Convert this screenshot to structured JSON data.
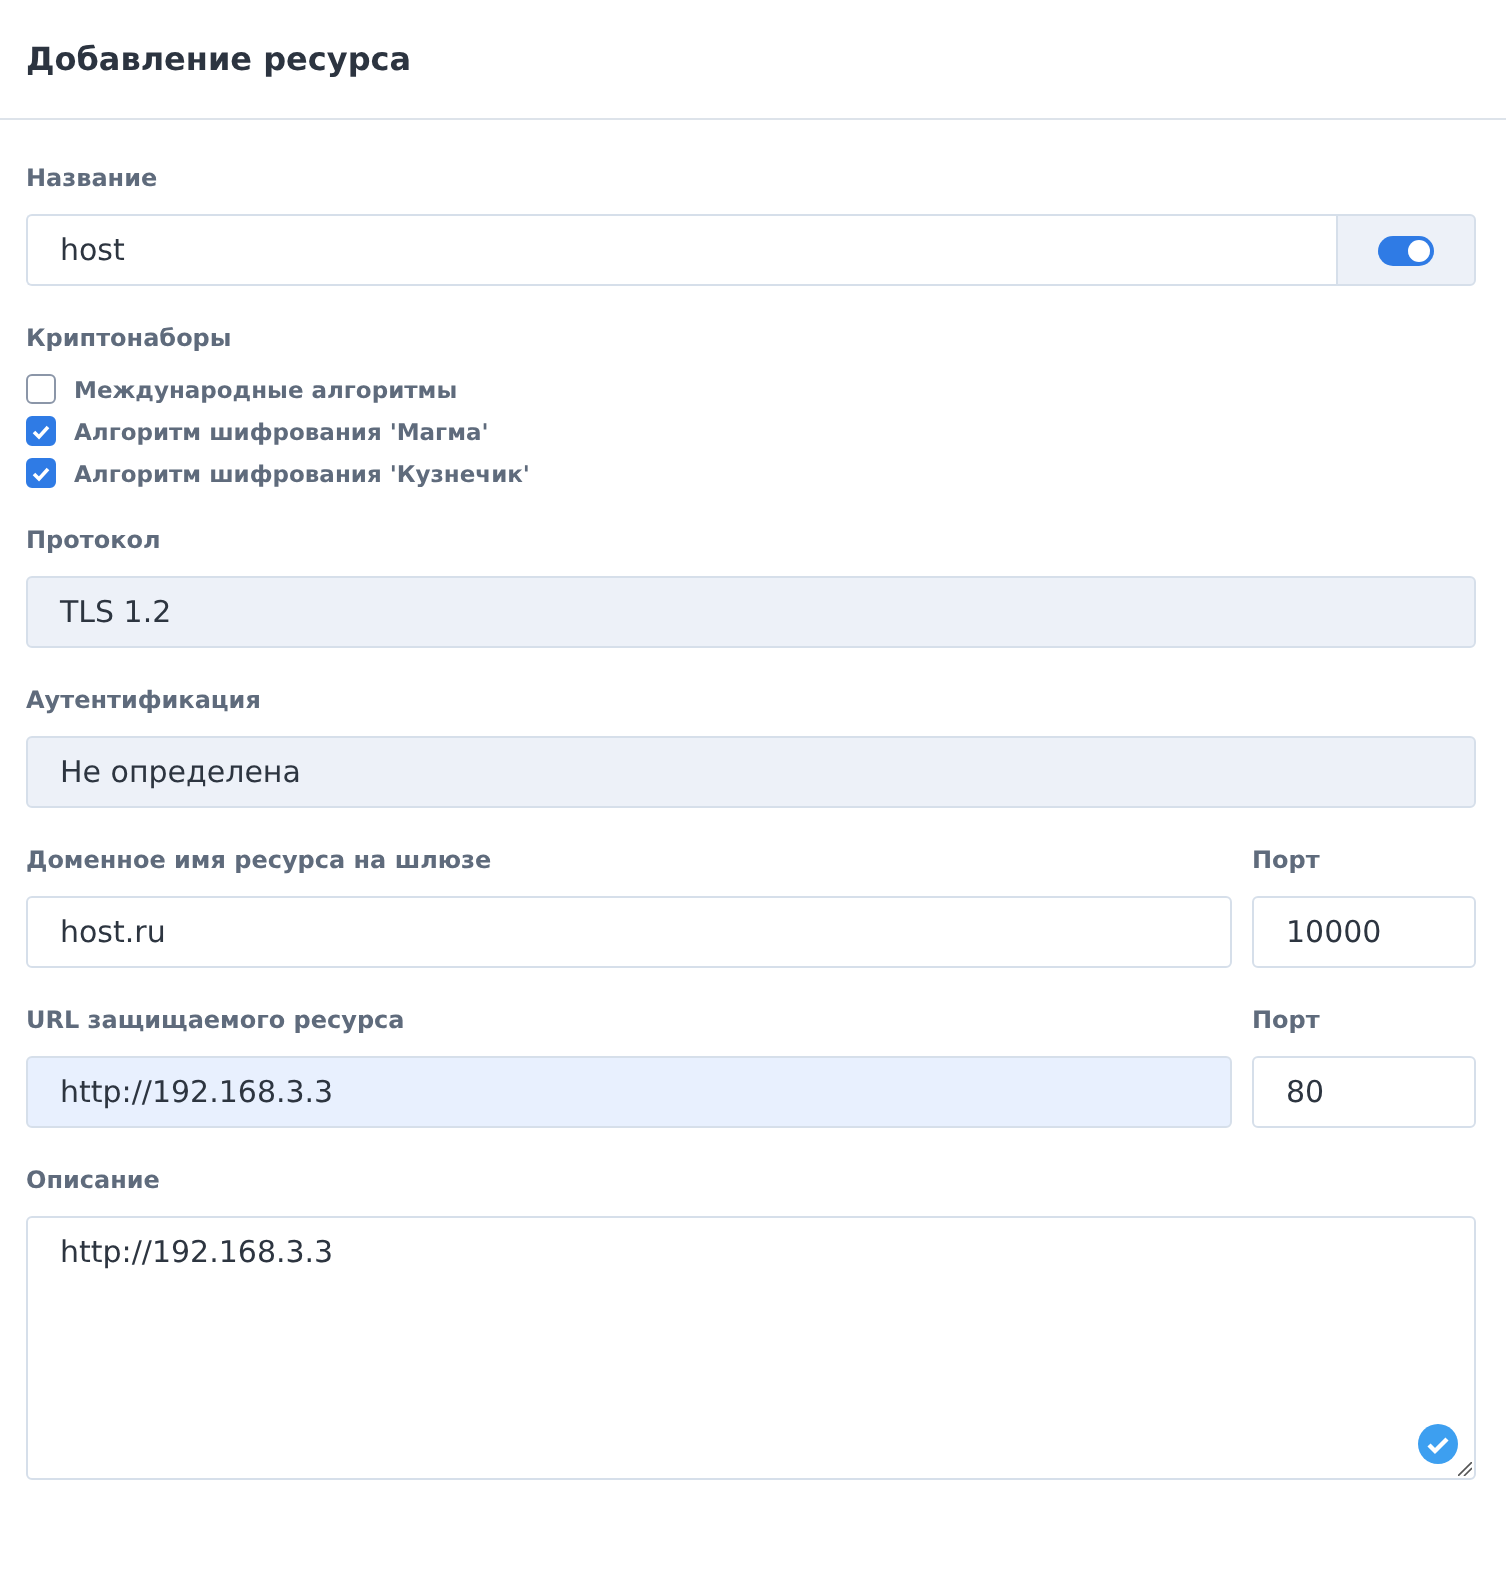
{
  "header": {
    "title": "Добавление ресурса"
  },
  "name_field": {
    "label": "Название",
    "value": "host",
    "enabled": true
  },
  "crypto": {
    "label": "Криптонаборы",
    "options": [
      {
        "label": "Международные алгоритмы",
        "checked": false
      },
      {
        "label": "Алгоритм шифрования 'Магма'",
        "checked": true
      },
      {
        "label": "Алгоритм шифрования 'Кузнечик'",
        "checked": true
      }
    ]
  },
  "fields": [
    {
      "label": "Протокол",
      "value": "TLS 1.2",
      "kind": "readonly"
    },
    {
      "label": "Аутентификация",
      "value": "Не определена",
      "kind": "readonly"
    }
  ],
  "address_rows": [
    {
      "label": "Доменное имя ресурса на шлюзе",
      "value": "host.ru",
      "kind": "text",
      "port_label": "Порт",
      "port": "10000"
    },
    {
      "label": "URL защищаемого ресурса",
      "value": "http://192.168.3.3",
      "kind": "autofill",
      "port_label": "Порт",
      "port": "80"
    }
  ],
  "description": {
    "label": "Описание",
    "value": "http://192.168.3.3",
    "valid": true
  }
}
